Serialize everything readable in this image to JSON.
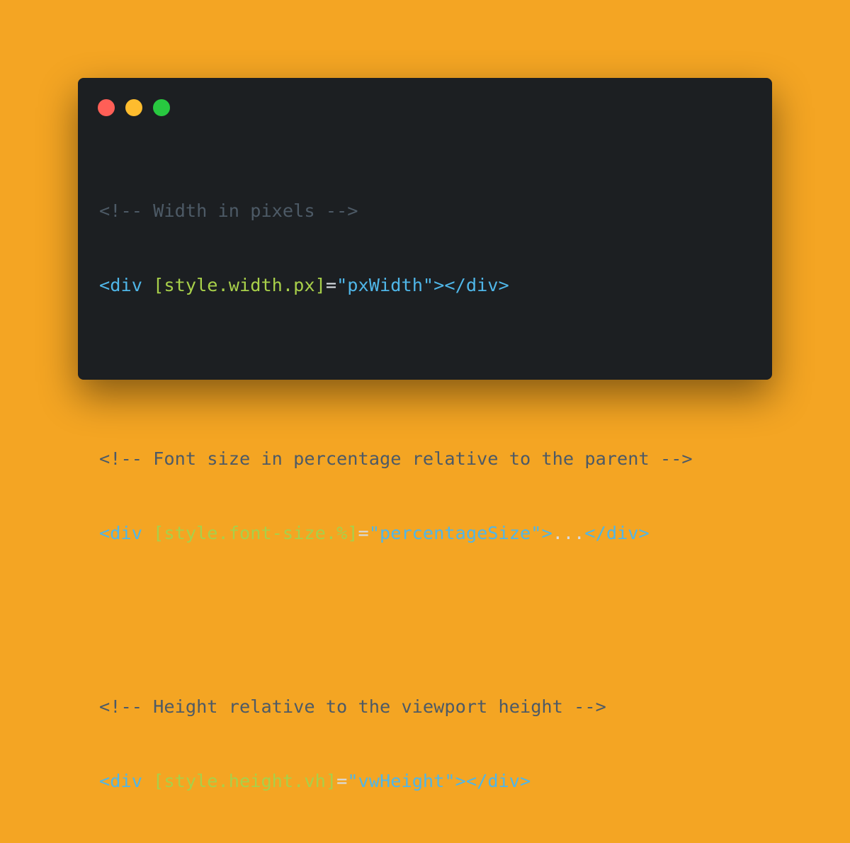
{
  "colors": {
    "background": "#F4A523",
    "window": "#1C1F22",
    "close": "#FF5F57",
    "minimize": "#FEBC2E",
    "maximize": "#28C840",
    "comment": "#4D5A66",
    "tag": "#4FB6E8",
    "attribute": "#A8D04A",
    "string": "#4FB6E8",
    "plain": "#D8DDE2"
  },
  "window_controls": [
    "close-button",
    "minimize-button",
    "maximize-button"
  ],
  "code": {
    "block1": {
      "comment": "<!-- Width in pixels -->",
      "open": "<div ",
      "attr": "[style.width.px]",
      "eq": "=",
      "value": "\"pxWidth\"",
      "close": "></div>"
    },
    "block2": {
      "comment": "<!-- Font size in percentage relative to the parent -->",
      "open": "<div ",
      "attr": "[style.font-size.%]",
      "eq": "=",
      "value": "\"percentageSize\"",
      "gt": ">",
      "content": "...",
      "close": "</div>"
    },
    "block3": {
      "comment": "<!-- Height relative to the viewport height -->",
      "open": "<div ",
      "attr": "[style.height.vh]",
      "eq": "=",
      "value": "\"vwHeight\"",
      "close": "></div>"
    }
  }
}
